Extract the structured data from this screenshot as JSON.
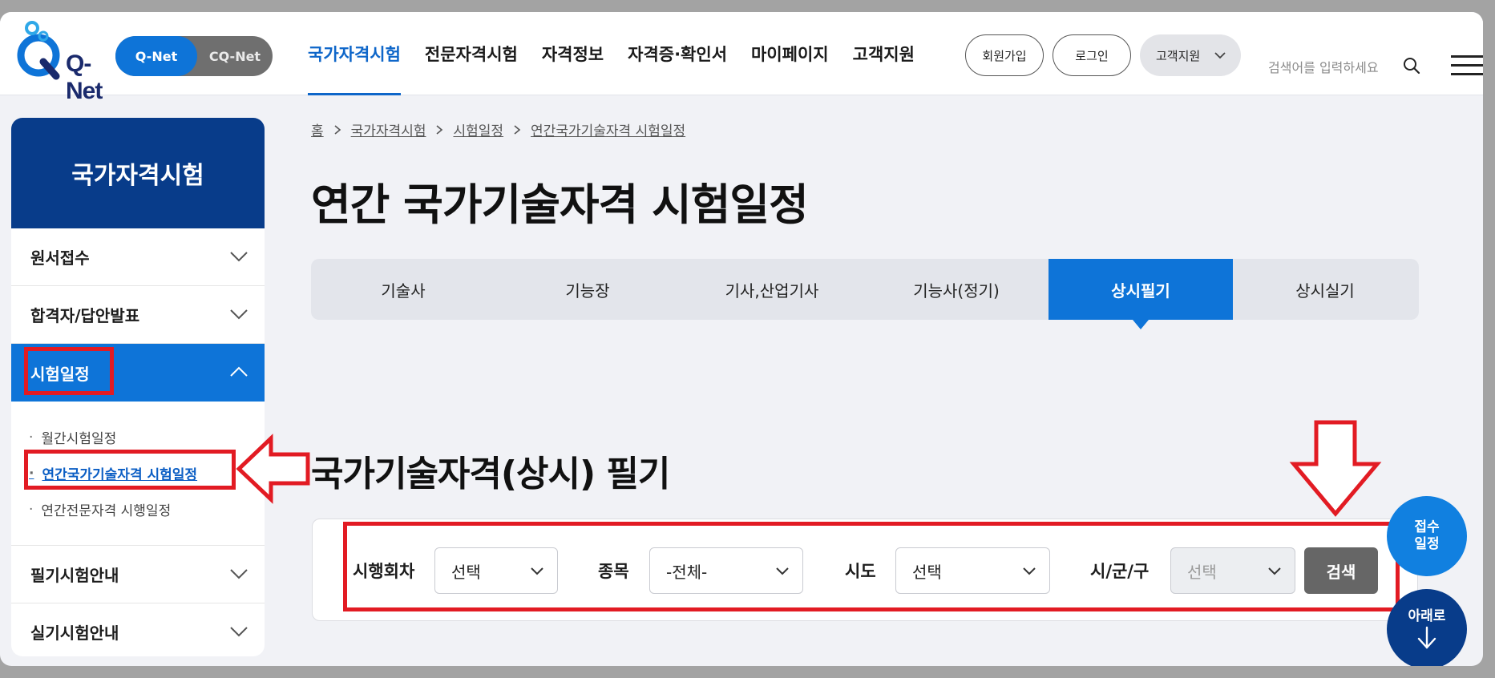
{
  "header": {
    "logo_text": "Q-Net",
    "site_toggle": {
      "primary": "Q-Net",
      "secondary": "CQ-Net"
    },
    "gnb": [
      "국가자격시험",
      "전문자격시험",
      "자격정보",
      "자격증·확인서",
      "마이페이지",
      "고객지원"
    ],
    "active_gnb_index": 0,
    "signup_label": "회원가입",
    "login_label": "로그인",
    "support_label": "고객지원",
    "search_placeholder": "검색어를 입력하세요"
  },
  "sidebar": {
    "title": "국가자격시험",
    "items": [
      {
        "label": "원서접수"
      },
      {
        "label": "합격자/답안발표"
      },
      {
        "label": "시험일정"
      },
      {
        "label": "필기시험안내"
      },
      {
        "label": "실기시험안내"
      }
    ],
    "submenu": [
      "월간시험일정",
      "연간국가기술자격 시험일정",
      "연간전문자격 시행일정"
    ]
  },
  "breadcrumb": [
    "홈",
    "국가자격시험",
    "시험일정",
    "연간국가기술자격 시험일정"
  ],
  "page_title": "연간 국가기술자격 시험일정",
  "tabs": [
    "기술사",
    "기능장",
    "기사,산업기사",
    "기능사(정기)",
    "상시필기",
    "상시실기"
  ],
  "active_tab_index": 4,
  "section_title": "국가기술자격(상시) 필기",
  "filters": {
    "round_label": "시행회차",
    "round_value": "선택",
    "item_label": "종목",
    "item_value": "-전체-",
    "region_label": "시도",
    "region_value": "선택",
    "district_label": "시/군/구",
    "district_value": "선택",
    "search_label": "검색"
  },
  "floating": {
    "apply_line1": "접수",
    "apply_line2": "일정",
    "down_label": "아래로"
  },
  "colors": {
    "primary": "#0e74d8",
    "navy": "#083c8a",
    "annotation": "#e21b23"
  }
}
